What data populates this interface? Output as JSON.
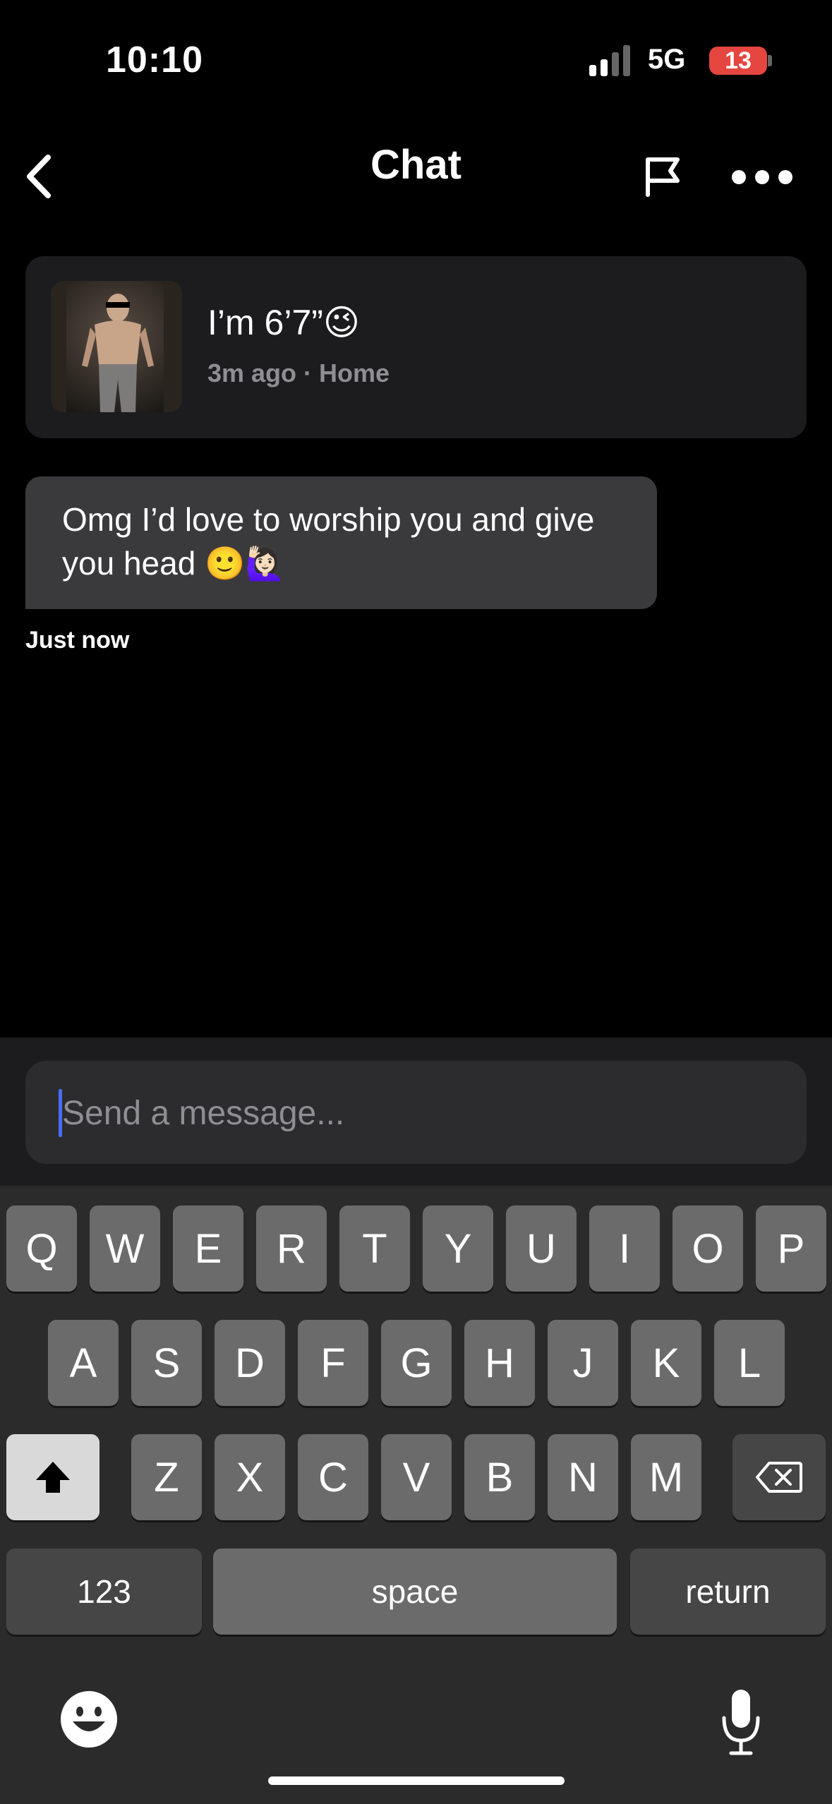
{
  "status_bar": {
    "time": "10:10",
    "network": "5G",
    "battery": "13",
    "battery_color": "#e5463f"
  },
  "header": {
    "title": "Chat",
    "back_icon": "chevron-left-icon",
    "flag_icon": "flag-icon",
    "more_icon": "more-horizontal-icon"
  },
  "post": {
    "text": "I’m 6’7”😉",
    "meta": "3m ago · Home"
  },
  "messages": [
    {
      "text": "Omg I’d love to worship you and give you head 🙂🙋🏻‍♀️",
      "time": "Just now"
    }
  ],
  "composer": {
    "placeholder": "Send a message...",
    "accent_color": "#4a6cf7"
  },
  "keyboard": {
    "row1": [
      "Q",
      "W",
      "E",
      "R",
      "T",
      "Y",
      "U",
      "I",
      "O",
      "P"
    ],
    "row2": [
      "A",
      "S",
      "D",
      "F",
      "G",
      "H",
      "J",
      "K",
      "L"
    ],
    "row3": [
      "Z",
      "X",
      "C",
      "V",
      "B",
      "N",
      "M"
    ],
    "numbers_label": "123",
    "space_label": "space",
    "return_label": "return",
    "shift_icon": "shift-icon",
    "delete_icon": "backspace-icon",
    "emoji_icon": "emoji-icon",
    "mic_icon": "microphone-icon"
  }
}
